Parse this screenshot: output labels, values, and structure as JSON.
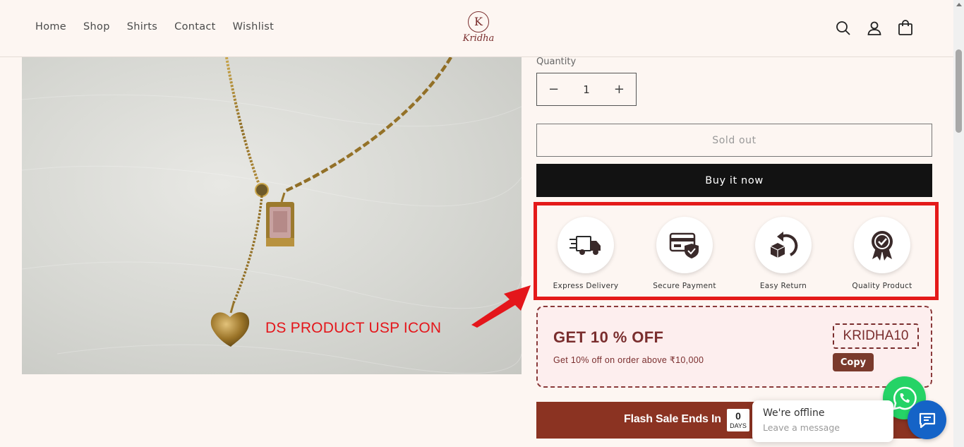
{
  "header": {
    "nav": [
      "Home",
      "Shop",
      "Shirts",
      "Contact",
      "Wishlist"
    ],
    "logo_text": "Kridha",
    "logo_initial": "K",
    "icons": [
      "search-icon",
      "account-icon",
      "cart-icon"
    ]
  },
  "product": {
    "quantity_label": "Quantity",
    "quantity_value": "1",
    "decrease_symbol": "−",
    "increase_symbol": "+",
    "sold_out_label": "Sold out",
    "buy_now_label": "Buy it now"
  },
  "annotation": {
    "text": "DS PRODUCT USP ICON",
    "color": "#e4161b"
  },
  "usps": [
    {
      "label": "Express Delivery",
      "icon": "delivery-truck-icon"
    },
    {
      "label": "Secure Payment",
      "icon": "secure-card-icon"
    },
    {
      "label": "Easy Return",
      "icon": "return-box-icon"
    },
    {
      "label": "Quality Product",
      "icon": "quality-badge-icon"
    }
  ],
  "coupon": {
    "title": "GET 10 % OFF",
    "subtitle": "Get 10% off on order above ₹10,000",
    "code": "KRIDHA10",
    "copy_label": "Copy"
  },
  "flash_sale": {
    "label": "Flash Sale Ends In",
    "days_value": "0",
    "days_unit": "DAYS"
  },
  "chat": {
    "status": "We're offline",
    "prompt": "Leave a message"
  },
  "colors": {
    "page_bg": "#fdf6f2",
    "brand": "#7a2e2e",
    "buy_now_bg": "#121212",
    "flash_bg": "#8b3322",
    "highlight_border": "#e41a1a",
    "whatsapp": "#25d366",
    "chat": "#1563c7"
  }
}
